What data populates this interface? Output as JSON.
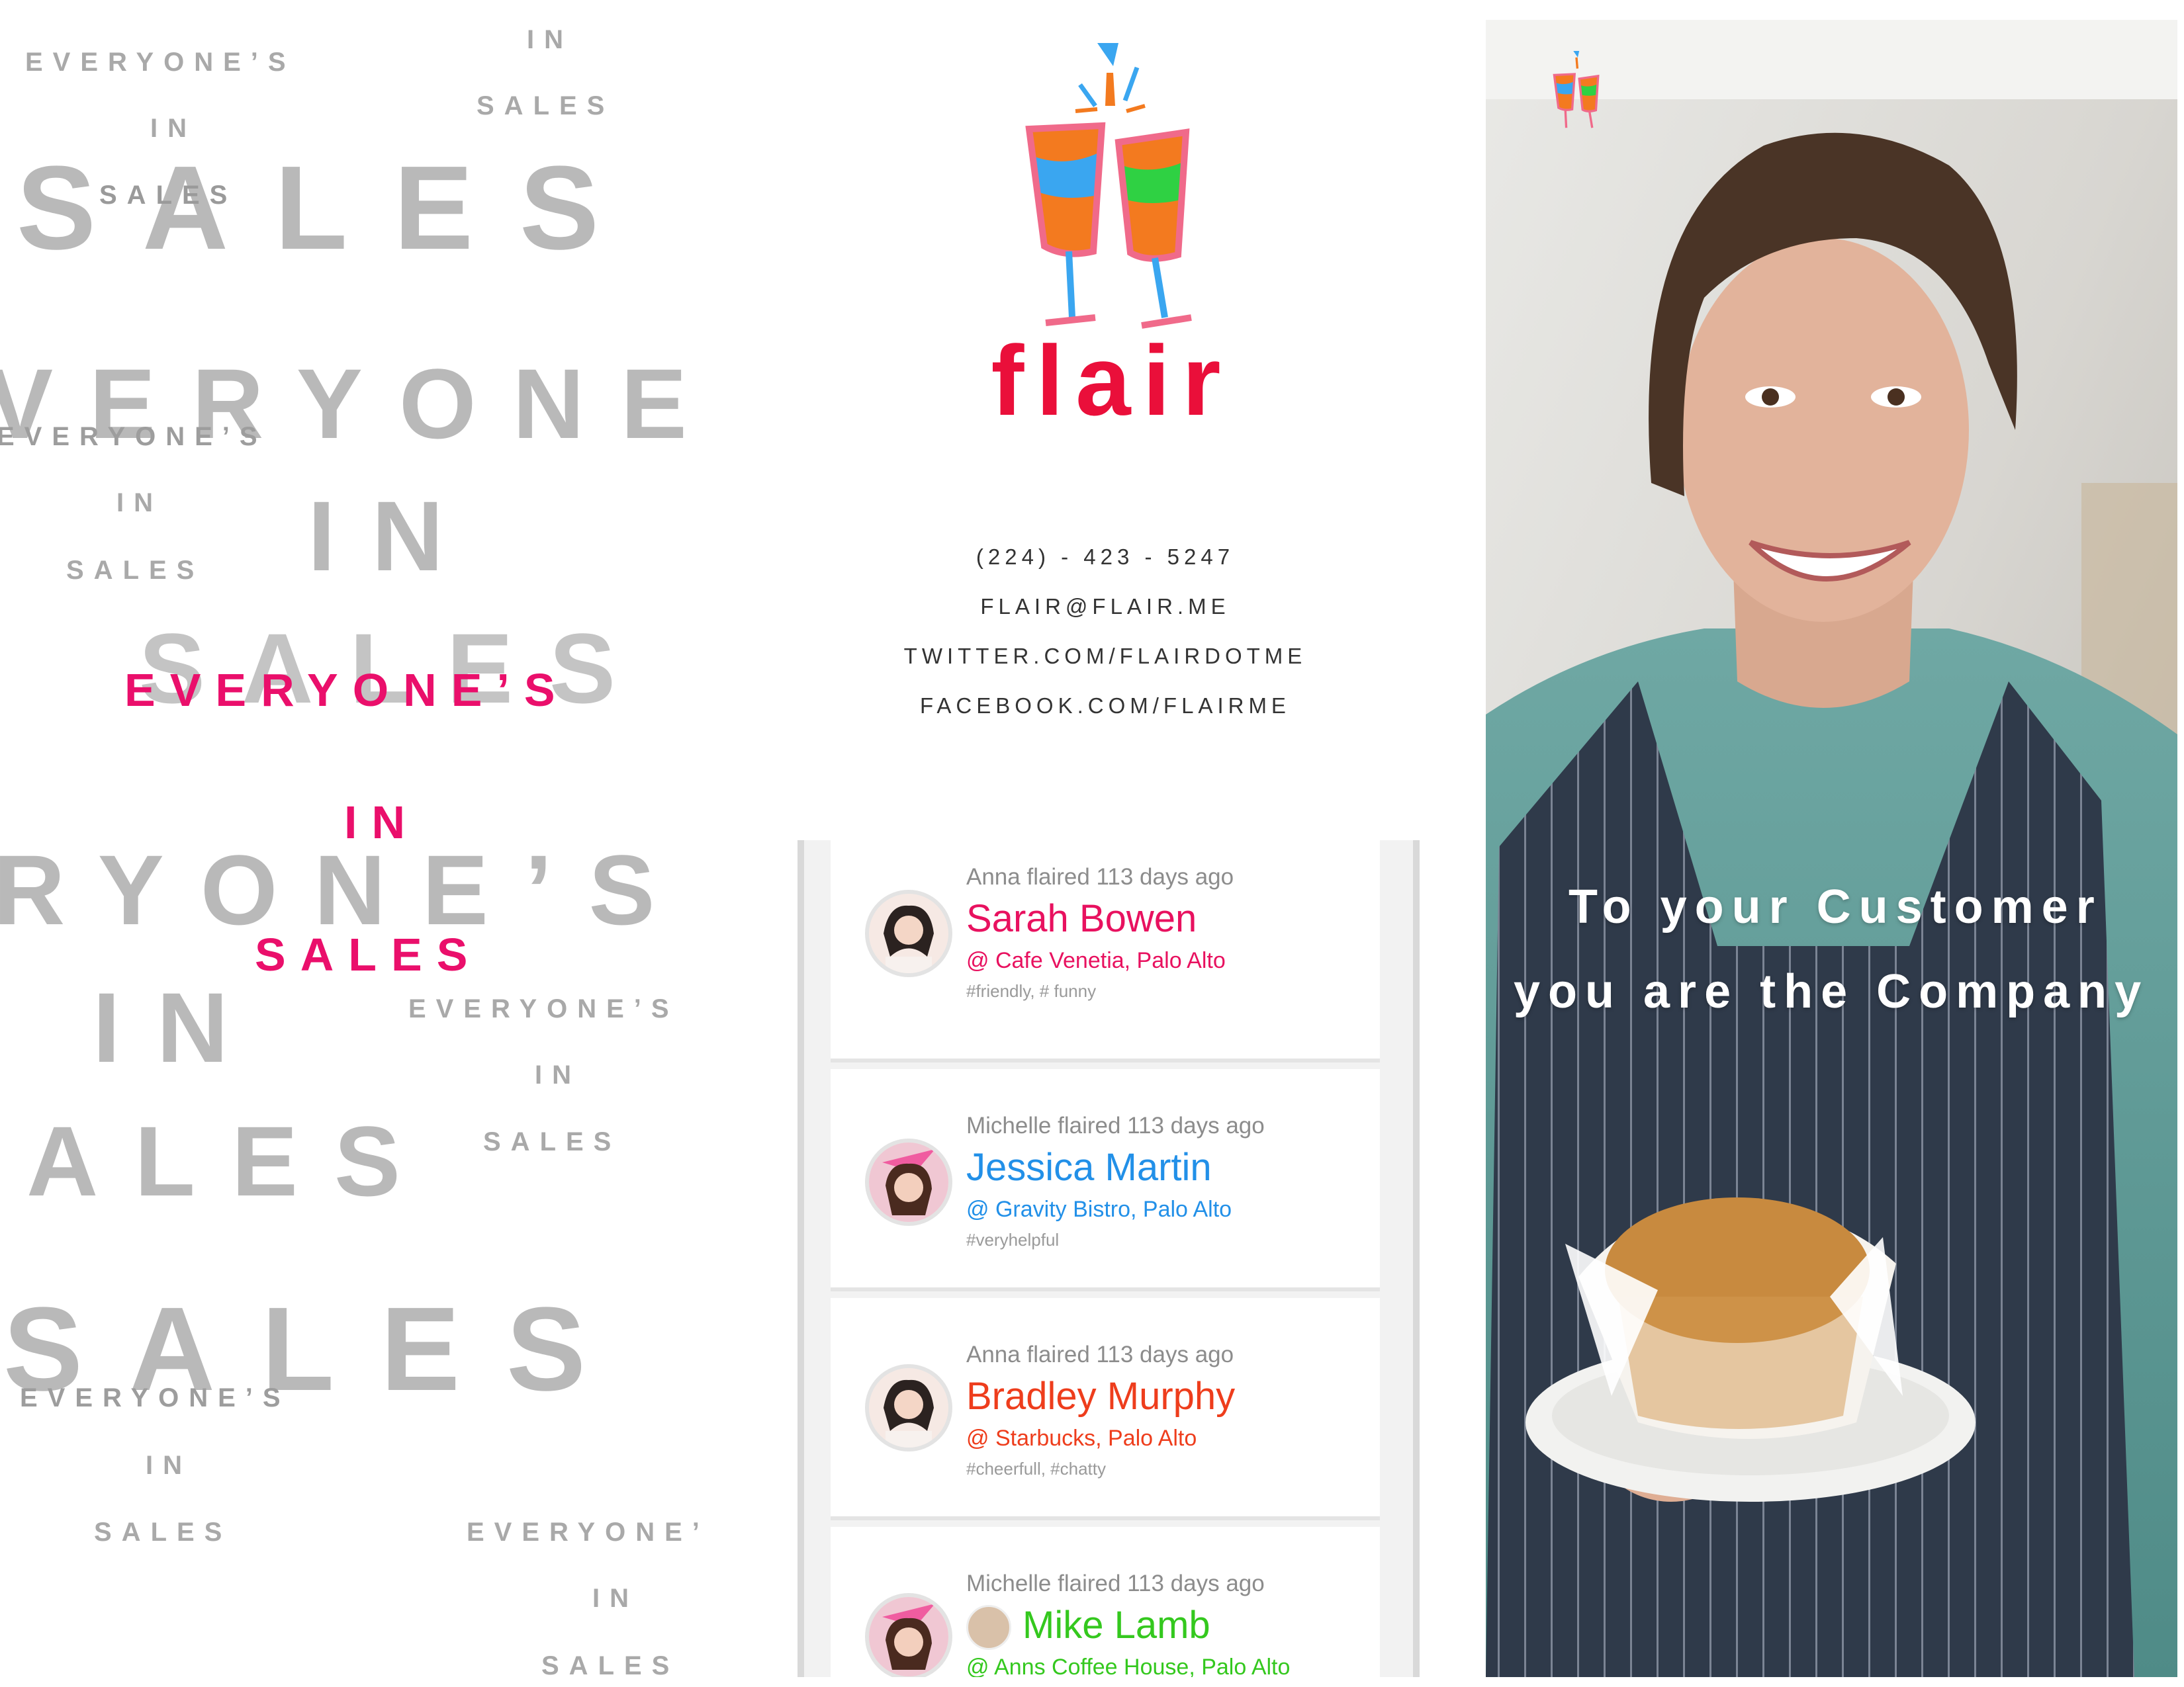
{
  "left_panel": {
    "words": {
      "everyones": "EVERYONE’S",
      "everyones_cut": "EVERYONE’",
      "in": "IN",
      "sales": "SALES",
      "sales_big": "SALES",
      "veryone": "VERYONE",
      "ryones": "RYONE’S",
      "ales": "ALES"
    },
    "highlight": {
      "line1": "EVERYONE’S",
      "line2": "IN",
      "line3": "SALES"
    }
  },
  "brand": {
    "name": "flair",
    "colors": {
      "pink": "#ea0f6b",
      "orange": "#f37a1f",
      "blue": "#3aa6f0",
      "green": "#2fd143",
      "glass_stroke": "#f06a8a"
    }
  },
  "contact": {
    "phone": "(224) - 423 - 5247",
    "email": "FLAIR@FLAIR.ME",
    "twitter": "TWITTER.COM/FLAIRDOTME",
    "facebook": "FACEBOOK.COM/FLAIRME"
  },
  "feed": [
    {
      "meta": "Anna flaired 113 days ago",
      "name": "Sarah Bowen",
      "place": "@ Cafe Venetia, Palo Alto",
      "tags": "#friendly, # funny",
      "color": "#e8115f"
    },
    {
      "meta": "Michelle flaired 113 days ago",
      "name": "Jessica Martin",
      "place": "@ Gravity Bistro, Palo Alto",
      "tags": "#veryhelpful",
      "color": "#2290e8"
    },
    {
      "meta": "Anna flaired 113 days ago",
      "name": "Bradley Murphy",
      "place": "@ Starbucks, Palo Alto",
      "tags": "#cheerfull, #chatty",
      "color": "#ee3d1c"
    },
    {
      "meta": "Michelle flaired 113 days ago",
      "name": "Mike Lamb",
      "place": "@ Anns Coffee House, Palo Alto",
      "tags": "",
      "color": "#34c81e"
    }
  ],
  "tagline": {
    "line1": "To your Customer",
    "line2": "you are the Company"
  }
}
